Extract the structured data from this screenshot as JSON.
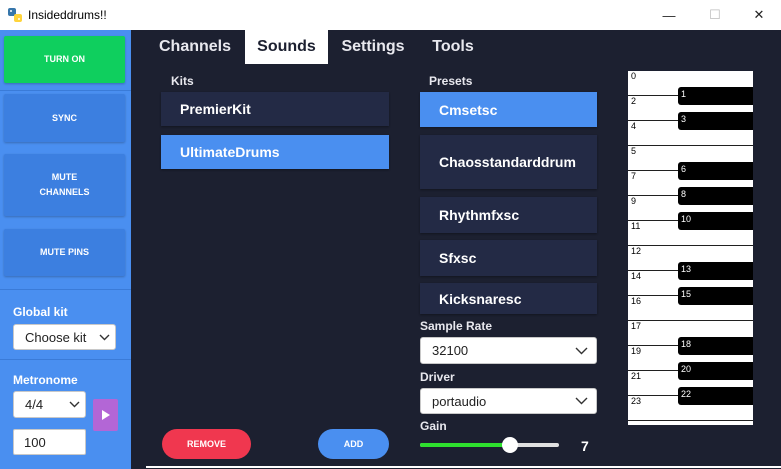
{
  "window": {
    "title": "Insideddrums!!",
    "minimize_glyph": "—",
    "maximize_glyph": "☐",
    "close_glyph": "✕"
  },
  "sidebar": {
    "turn_on": "TURN ON",
    "sync": "SYNC",
    "mute_channels": "MUTE\nCHANNELS",
    "mute_pins": "MUTE PINS",
    "global_kit_label": "Global kit",
    "global_kit_value": "Choose kit",
    "metronome_label": "Metronome",
    "metronome_value": "4/4",
    "bpm_value": "100"
  },
  "tabs": [
    {
      "label": "Channels",
      "active": false
    },
    {
      "label": "Sounds",
      "active": true
    },
    {
      "label": "Settings",
      "active": false
    },
    {
      "label": "Tools",
      "active": false
    }
  ],
  "kits": {
    "label": "Kits",
    "items": [
      {
        "label": "PremierKit",
        "selected": false
      },
      {
        "label": "UltimateDrums",
        "selected": true
      }
    ]
  },
  "presets": {
    "label": "Presets",
    "items": [
      {
        "label": "Cmsetsc",
        "selected": true
      },
      {
        "label": "Chaosstandarddrum",
        "selected": false
      },
      {
        "label": "Rhythmfxsc",
        "selected": false
      },
      {
        "label": "Sfxsc",
        "selected": false
      },
      {
        "label": "Kicksnaresc",
        "selected": false
      }
    ]
  },
  "sample_rate": {
    "label": "Sample Rate",
    "value": "32100"
  },
  "driver": {
    "label": "Driver",
    "value": "portaudio"
  },
  "gain": {
    "label": "Gain",
    "value": "7",
    "fraction": 0.65
  },
  "buttons": {
    "remove": "REMOVE",
    "add": "ADD"
  },
  "piano": {
    "white_keys": [
      "0",
      "2",
      "4",
      "5",
      "7",
      "9",
      "11",
      "12",
      "14",
      "16",
      "17",
      "19",
      "21",
      "23"
    ],
    "black_keys": [
      "1",
      "3",
      "6",
      "8",
      "10",
      "13",
      "15",
      "18",
      "20",
      "22"
    ]
  },
  "colors": {
    "sidebar": "#4a8ff0",
    "main_bg": "#1c2030",
    "item_bg": "#232a45",
    "accent": "#4a8ff0",
    "turn_on": "#0fcf5e",
    "remove": "#f0374f",
    "play": "#b366d6",
    "slider": "#2ee02e"
  }
}
